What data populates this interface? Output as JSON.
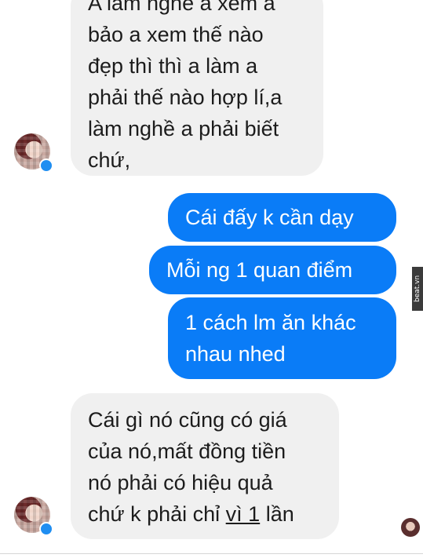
{
  "messages": [
    {
      "side": "in",
      "lines": [
        "A làm nghề a xem a",
        "bảo a xem thế nào",
        "đẹp thì thì a làm a",
        "phải thế nào hợp lí,a",
        "làm nghề a phải biết",
        "chứ,"
      ]
    },
    {
      "side": "out",
      "lines": [
        "Cái đấy k cần dạy"
      ]
    },
    {
      "side": "out",
      "lines": [
        "Mỗi ng 1 quan điểm"
      ]
    },
    {
      "side": "out",
      "lines": [
        "1 cách lm ăn khác",
        "nhau nhed"
      ]
    },
    {
      "side": "in",
      "lines": [
        "Cái gì nó cũng có giá",
        "của nó,mất đồng tiền",
        "nó phải có hiệu quả"
      ],
      "last_line": {
        "before": "chứ k phải chỉ ",
        "underlined": "vì 1",
        "after": " lần"
      }
    }
  ],
  "watermark": "beat.vn",
  "colors": {
    "incoming_bg": "#f0f0f0",
    "outgoing_bg": "#0a7cf7",
    "outgoing_text": "#ffffff"
  }
}
